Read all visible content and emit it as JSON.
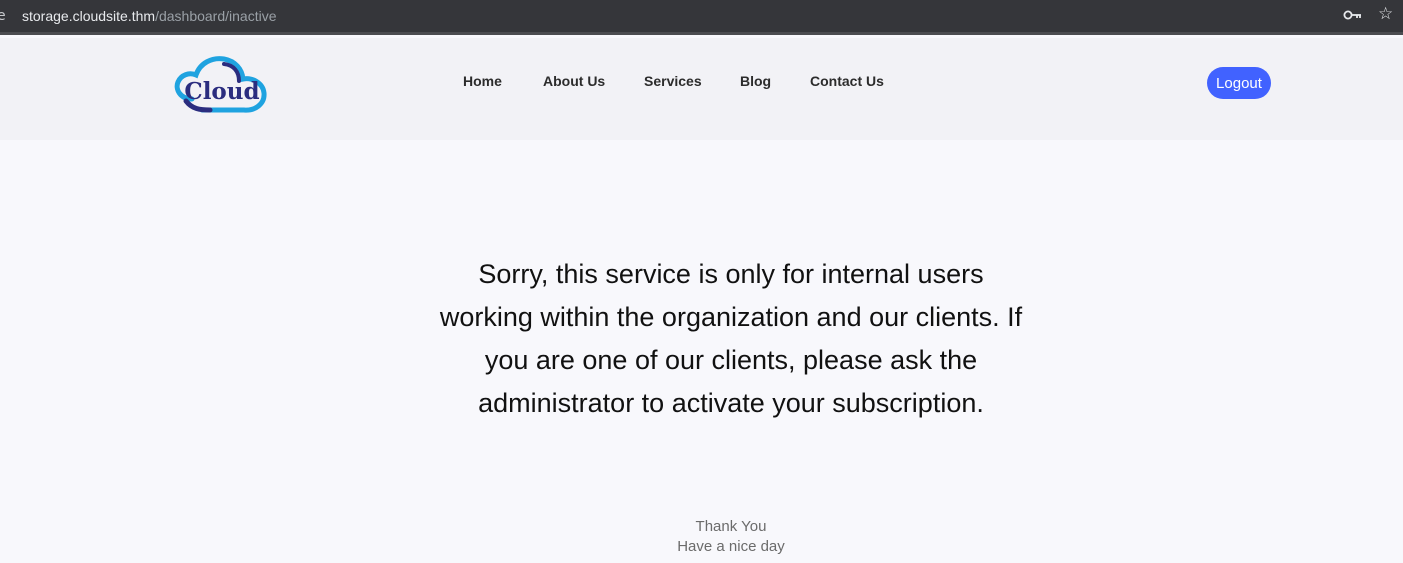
{
  "browser": {
    "url_host": "storage.cloudsite.thm",
    "url_path": "/dashboard/inactive",
    "site_info_glyph": "e",
    "icons": [
      "site-info-icon",
      "key-icon",
      "star-icon"
    ]
  },
  "header": {
    "logo_text": "Cloud",
    "nav": {
      "home": "Home",
      "about": "About Us",
      "services": "Services",
      "blog": "Blog",
      "contact": "Contact Us"
    },
    "logout_label": "Logout"
  },
  "main": {
    "message": "Sorry, this service is only for internal users working within the organization and our clients. If you are one of our clients, please ask the administrator to activate your subscription.",
    "thank_you": "Thank You",
    "nice_day": "Have a nice day"
  },
  "colors": {
    "accent": "#4162ff",
    "logo_dark": "#2b2d7f",
    "logo_light": "#1fa3e0"
  }
}
